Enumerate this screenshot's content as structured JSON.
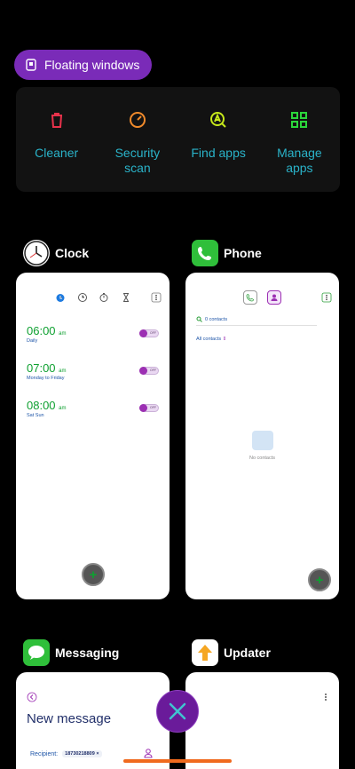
{
  "floating_windows": {
    "label": "Floating windows"
  },
  "tools": [
    {
      "label": "Cleaner",
      "icon": "trash-icon",
      "color": "#e8324b"
    },
    {
      "label": "Security scan",
      "icon": "gauge-icon",
      "color": "#f08a2b"
    },
    {
      "label": "Find apps",
      "icon": "find-apps-icon",
      "color": "#c6e81b"
    },
    {
      "label": "Manage apps",
      "icon": "grid-icon",
      "color": "#2bd63b"
    }
  ],
  "apps": {
    "clock": {
      "name": "Clock",
      "alarms": [
        {
          "time": "06:00",
          "ampm": "am",
          "desc": "Daily",
          "state": "OFF"
        },
        {
          "time": "07:00",
          "ampm": "am",
          "desc": "Monday to Friday",
          "state": "OFF"
        },
        {
          "time": "08:00",
          "ampm": "am",
          "desc": "Sat Sun",
          "state": "OFF"
        }
      ],
      "fab": "+"
    },
    "phone": {
      "name": "Phone",
      "search": "0 contacts",
      "all_contacts": "All contacts",
      "empty": "No contacts",
      "fab": "+"
    },
    "messaging": {
      "name": "Messaging",
      "title": "New message",
      "recipient_label": "Recipient:",
      "recipient_number": "18730218809"
    },
    "updater": {
      "name": "Updater"
    }
  },
  "colors": {
    "accent": "#7a2bb8",
    "tool_text": "#2ab3c9",
    "home_bar": "#f06a1e"
  }
}
